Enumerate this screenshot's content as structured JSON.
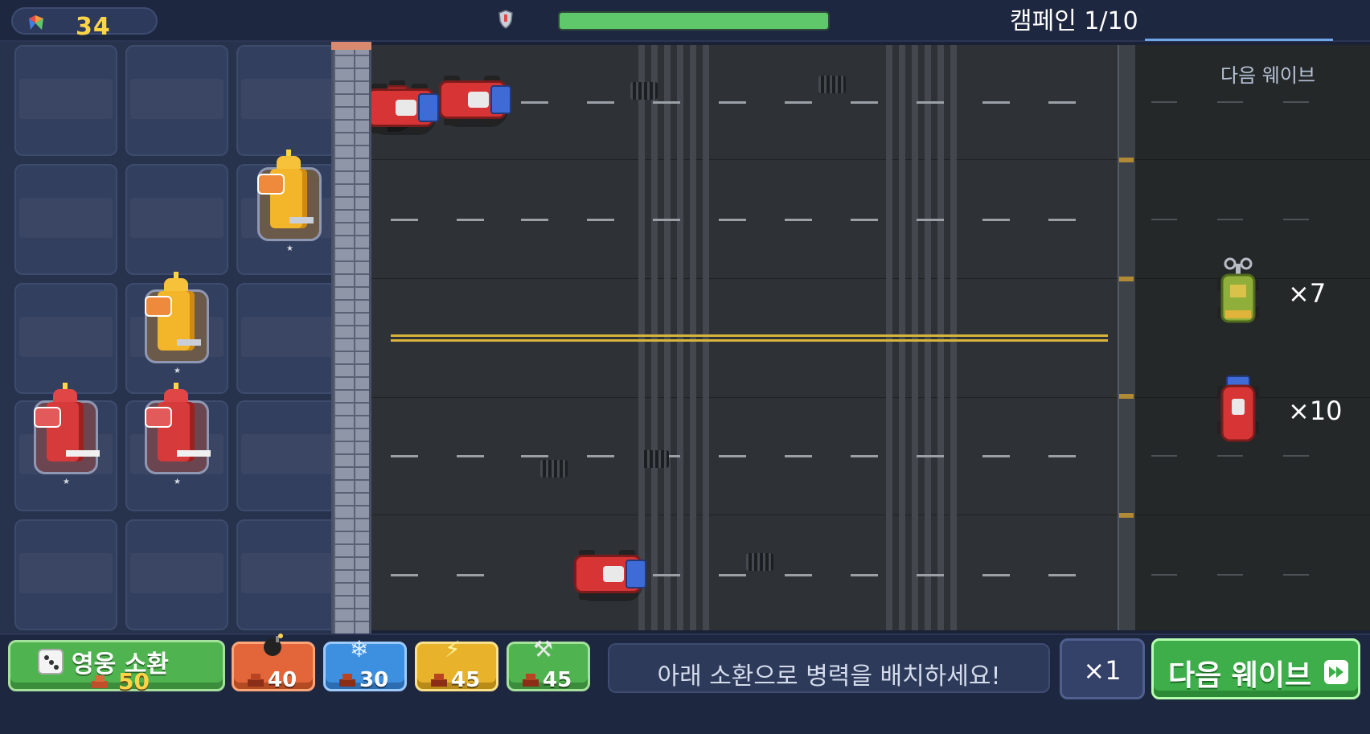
{
  "topbar": {
    "coins": "34",
    "campaign": "캠페인 1/10",
    "base_health": 1.0
  },
  "next_wave_panel": {
    "title": "다음 웨이브",
    "enemies": [
      {
        "icon": "green-windup-car-icon",
        "count": "×7"
      },
      {
        "icon": "red-race-car-icon",
        "count": "×10"
      }
    ]
  },
  "bottombar": {
    "summon_label": "영웅 소환",
    "summon_cost": "50",
    "skills": [
      {
        "icon": "bomb-icon",
        "cost": "40"
      },
      {
        "icon": "snowflake-icon",
        "cost": "30"
      },
      {
        "icon": "lightning-icon",
        "cost": "45"
      },
      {
        "icon": "hammer-wrench-icon",
        "cost": "45"
      }
    ],
    "message": "아래 소환으로 병력을 배치하세요!",
    "speed": "×1",
    "next_wave": "다음 웨이브"
  },
  "colors": {
    "coin": "#ffd449",
    "health": "#5ec86a",
    "road": "#2e3236",
    "enemy_car": "#d73535"
  }
}
